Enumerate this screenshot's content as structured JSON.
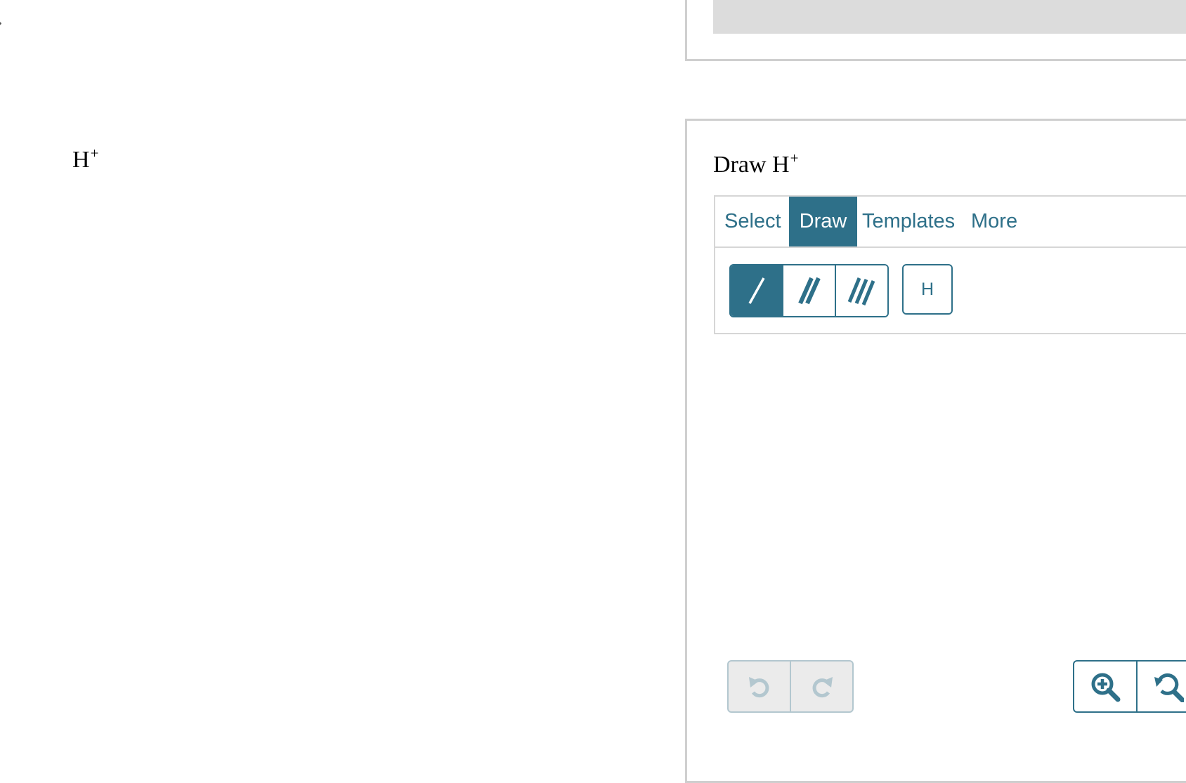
{
  "left": {
    "edge_glyph": "»",
    "ion": {
      "symbol": "H",
      "charge": "+"
    }
  },
  "panel": {
    "title_prefix": "Draw H",
    "title_charge": "+"
  },
  "editor": {
    "tabs": [
      "Select",
      "Draw",
      "Templates",
      "More"
    ],
    "active_tab": "Draw",
    "bond_tools": [
      "single-bond",
      "double-bond",
      "triple-bond"
    ],
    "active_bond_tool": "single-bond",
    "atom_button": "H"
  },
  "colors": {
    "accent": "#2e7089",
    "disabled": "#b3c7cf",
    "border": "#cfcfcf"
  }
}
